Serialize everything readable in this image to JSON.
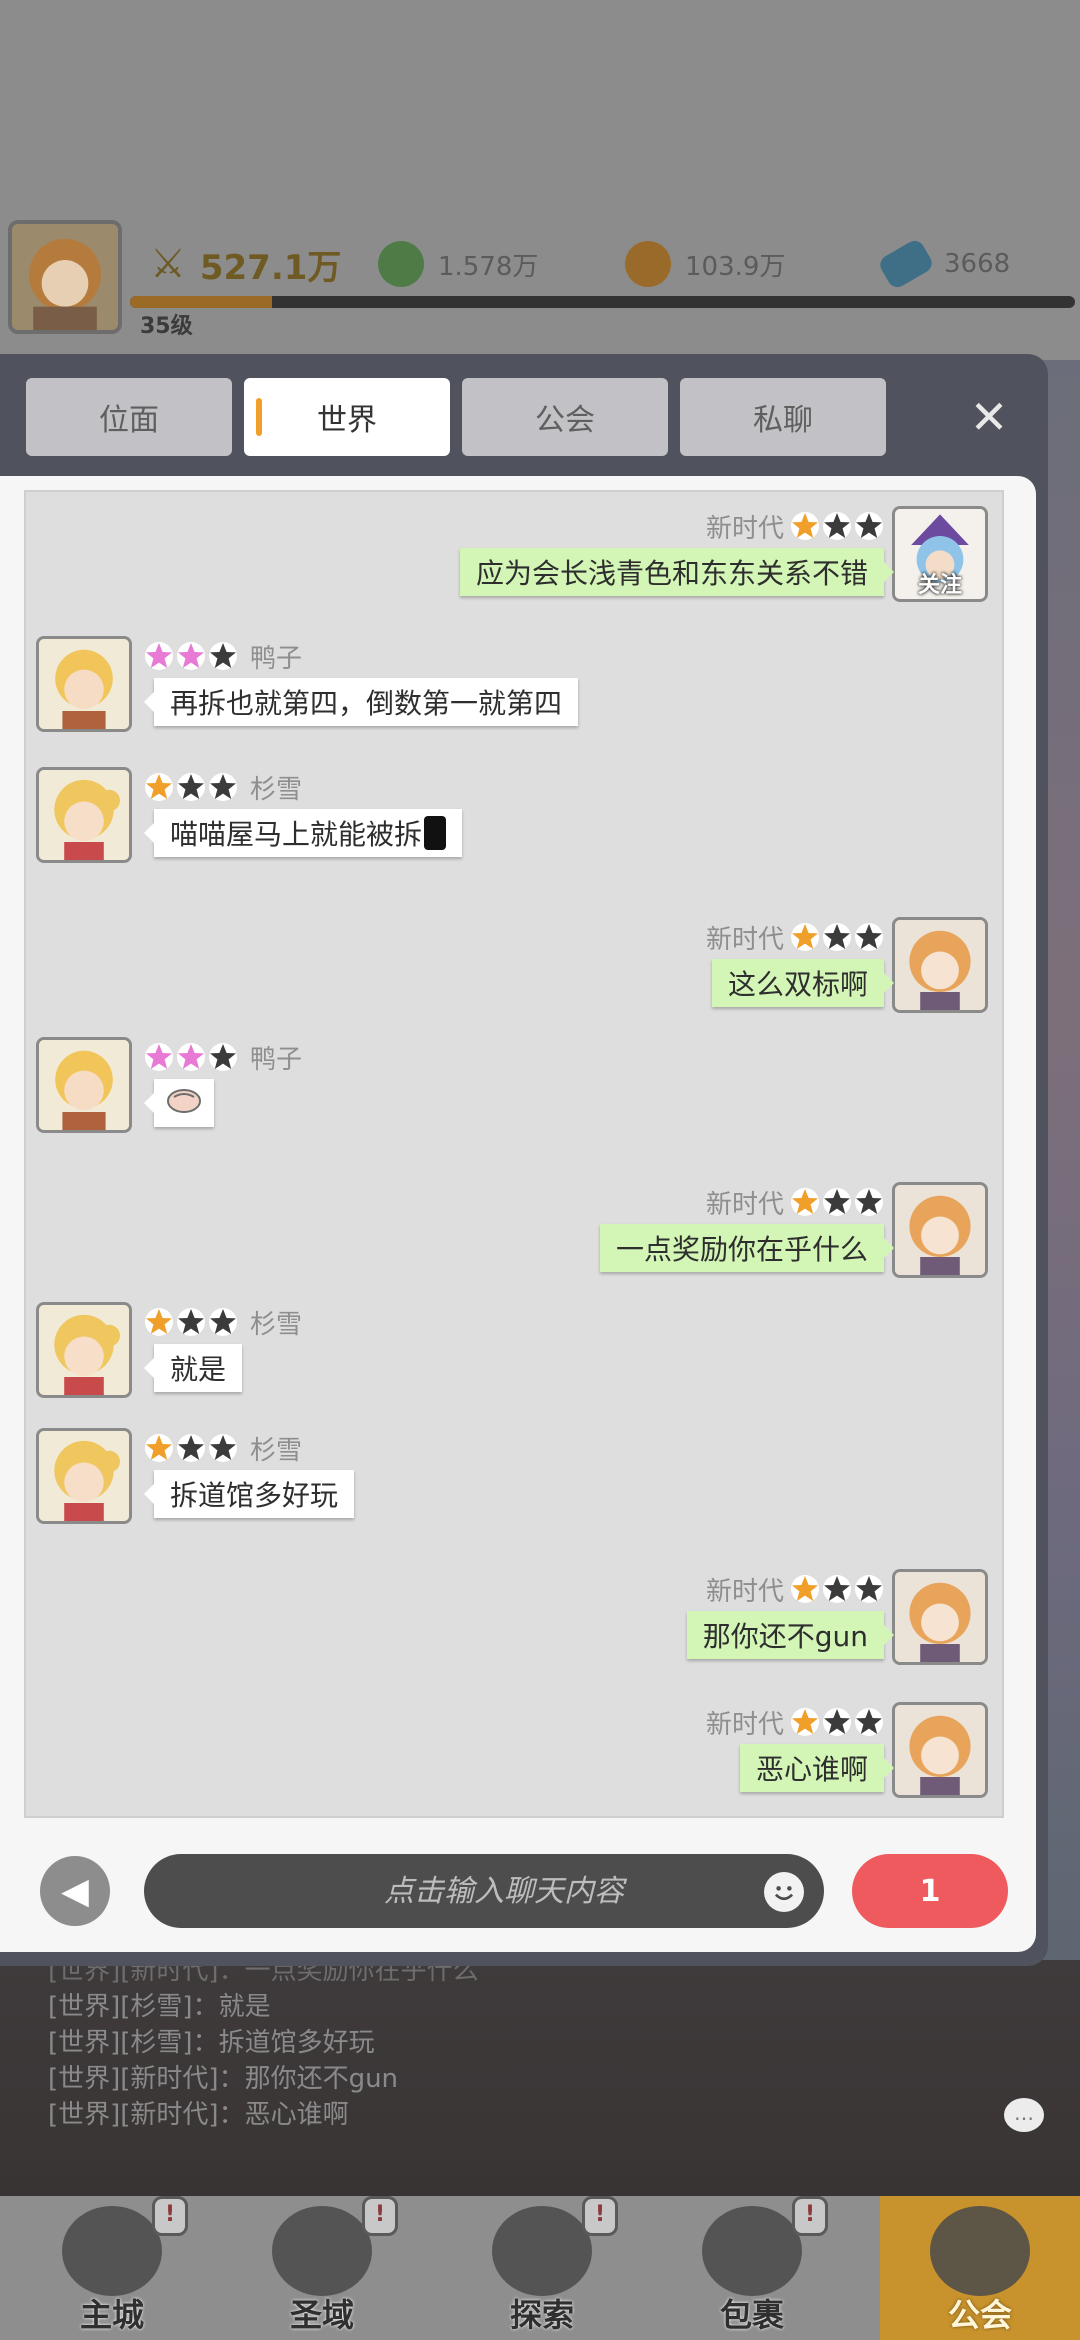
{
  "resources": {
    "power": "527.1万",
    "gold": "1.578万",
    "orange": "103.9万",
    "gem": "3668",
    "level": "35级",
    "xp_fraction": 0.15
  },
  "tabs": [
    {
      "label": "位面",
      "active": false
    },
    {
      "label": "世界",
      "active": true
    },
    {
      "label": "公会",
      "active": false
    },
    {
      "label": "私聊",
      "active": false
    }
  ],
  "messages": [
    {
      "side": "right",
      "name": "新时代",
      "stars": 1,
      "star_color": "orange",
      "text": "应为会长浅青色和东东关系不错",
      "avatar": "blue-hair-witch",
      "badge": "关注"
    },
    {
      "side": "left",
      "name": "鸭子",
      "stars": 2,
      "star_color": "pink",
      "text": "再拆也就第四，倒数第一就第四",
      "avatar": "blonde-boy"
    },
    {
      "side": "left",
      "name": "杉雪",
      "stars": 1,
      "star_color": "orange",
      "text": "喵喵屋马上就能被拆",
      "avatar": "blonde-girl"
    },
    {
      "side": "right",
      "name": "新时代",
      "stars": 1,
      "star_color": "orange",
      "text": "这么双标啊",
      "avatar": "orange-hair-girl"
    },
    {
      "side": "left",
      "name": "鸭子",
      "stars": 2,
      "star_color": "pink",
      "text": "",
      "avatar": "blonde-boy"
    },
    {
      "side": "right",
      "name": "新时代",
      "stars": 1,
      "star_color": "orange",
      "text": "一点奖励你在乎什么",
      "avatar": "orange-hair-girl"
    },
    {
      "side": "left",
      "name": "杉雪",
      "stars": 1,
      "star_color": "orange",
      "text": "就是",
      "avatar": "blonde-girl"
    },
    {
      "side": "left",
      "name": "杉雪",
      "stars": 1,
      "star_color": "orange",
      "text": "拆道馆多好玩",
      "avatar": "blonde-girl"
    },
    {
      "side": "right",
      "name": "新时代",
      "stars": 1,
      "star_color": "orange",
      "text": "那你还不gun",
      "avatar": "orange-hair-girl"
    },
    {
      "side": "right",
      "name": "新时代",
      "stars": 1,
      "star_color": "orange",
      "text": "恶心谁啊",
      "avatar": "orange-hair-girl"
    }
  ],
  "input": {
    "placeholder": "点击输入聊天内容",
    "send_label": "1"
  },
  "log": [
    "[世界][杉雪]：就是",
    "[世界][杉雪]：拆道馆多好玩",
    "[世界][新时代]：那你还不gun",
    "[世界][新时代]：恶心谁啊"
  ],
  "log_partial": "[世界][新时代]：一点奖励你在乎什么",
  "nav": [
    {
      "label": "主城",
      "active": false
    },
    {
      "label": "圣域",
      "active": false
    },
    {
      "label": "探索",
      "active": false
    },
    {
      "label": "包裹",
      "active": false
    },
    {
      "label": "公会",
      "active": true
    }
  ],
  "colors": {
    "star_orange": "#f0a02a",
    "star_pink": "#e87ad6",
    "star_empty": "#3b3b3b",
    "bubble_self": "#d3f5b6",
    "bubble_other": "#ffffff",
    "send_button": "#ee5a5e"
  }
}
